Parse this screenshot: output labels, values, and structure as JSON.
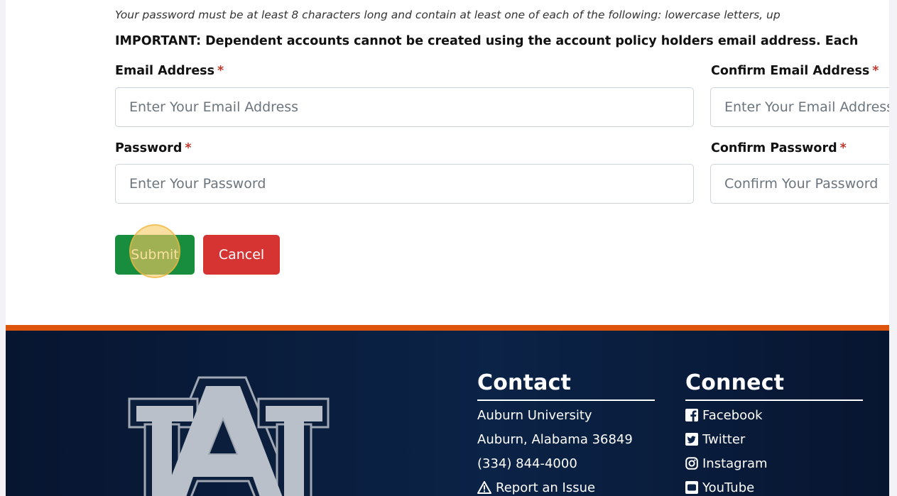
{
  "form": {
    "password_note": "Your password must be at least 8 characters long and contain at least one of each of the following: lowercase letters, up",
    "important_note": "IMPORTANT: Dependent accounts cannot be created using the account policy holders email address. Each",
    "required_mark": "*",
    "email": {
      "label": "Email Address",
      "placeholder": "Enter Your Email Address"
    },
    "confirm_email": {
      "label": "Confirm Email Address",
      "placeholder": "Enter Your Email Address"
    },
    "password": {
      "label": "Password",
      "placeholder": "Enter Your Password"
    },
    "confirm_password": {
      "label": "Confirm Password",
      "placeholder": "Confirm Your Password"
    },
    "submit_label": "Submit",
    "cancel_label": "Cancel"
  },
  "footer": {
    "contact": {
      "heading": "Contact",
      "lines": [
        "Auburn University",
        "Auburn, Alabama 36849",
        "(334) 844-4000"
      ],
      "report_link": "Report an Issue"
    },
    "connect": {
      "heading": "Connect",
      "links": [
        {
          "label": "Facebook",
          "icon": "facebook-icon"
        },
        {
          "label": "Twitter",
          "icon": "twitter-icon"
        },
        {
          "label": "Instagram",
          "icon": "instagram-icon"
        },
        {
          "label": "YouTube",
          "icon": "youtube-icon"
        }
      ]
    }
  },
  "colors": {
    "submit": "#198d3e",
    "cancel": "#d63333",
    "footer_bg": "#0b2347",
    "footer_stripe": "#dd550c",
    "required": "#c0392b"
  }
}
